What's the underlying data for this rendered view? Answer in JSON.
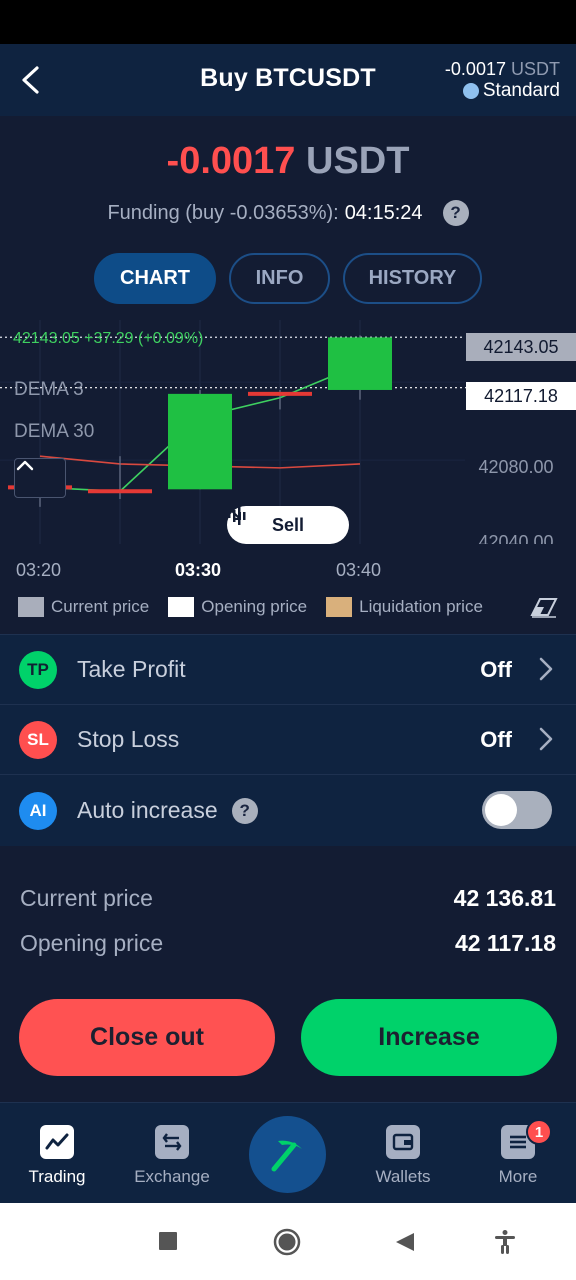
{
  "header": {
    "title": "Buy BTCUSDT",
    "pnl_small": "-0.0017",
    "pnl_small_unit": "USDT",
    "mode": "Standard"
  },
  "summary": {
    "pnl_value": "-0.0017",
    "pnl_unit": "USDT",
    "funding_label": "Funding (buy -0.03653%):",
    "funding_time": "04:15:24"
  },
  "tabs": [
    "CHART",
    "INFO",
    "HISTORY"
  ],
  "chart": {
    "ticker": "42143.05  +37.29 (+0.09%)",
    "indicator1": "DEMA 3",
    "indicator2": "DEMA 30",
    "current_price_tag": "42143.05",
    "opening_price_tag": "42117.18",
    "axis_labels": [
      "42080.00",
      "42040.00"
    ],
    "sell_label": "Sell",
    "time_labels": [
      "03:20",
      "03:30",
      "03:40"
    ]
  },
  "chart_data": {
    "type": "candlestick",
    "x": [
      "03:20",
      "03:25",
      "03:30",
      "03:35",
      "03:40"
    ],
    "ohlc": [
      {
        "t": "03:20",
        "open": 42066,
        "high": 42070,
        "low": 42056,
        "close": 42066
      },
      {
        "t": "03:25",
        "open": 42064,
        "high": 42082,
        "low": 42060,
        "close": 42064
      },
      {
        "t": "03:30",
        "open": 42065,
        "high": 42116,
        "low": 42065,
        "close": 42114
      },
      {
        "t": "03:35",
        "open": 42114,
        "high": 42116,
        "low": 42106,
        "close": 42114
      },
      {
        "t": "03:40",
        "open": 42116,
        "high": 42144,
        "low": 42111,
        "close": 42143
      }
    ],
    "series": [
      {
        "name": "DEMA 3",
        "x": [
          "03:20",
          "03:25",
          "03:30",
          "03:35",
          "03:40"
        ],
        "values": [
          42066,
          42064,
          42102,
          42112,
          42129
        ]
      },
      {
        "name": "DEMA 30",
        "x": [
          "03:20",
          "03:25",
          "03:30",
          "03:35",
          "03:40"
        ],
        "values": [
          42082,
          42078,
          42077,
          42076,
          42078
        ]
      }
    ],
    "current_price": 42143.05,
    "opening_price": 42117.18,
    "ylim": [
      42040,
      42155
    ],
    "colors": {
      "up": "#1fc043",
      "down": "#e53935",
      "dema3": "#3ed060",
      "dema30": "#d9493f"
    }
  },
  "legend": [
    {
      "label": "Current price",
      "color": "#a9aebb"
    },
    {
      "label": "Opening price",
      "color": "#ffffff"
    },
    {
      "label": "Liquidation price",
      "color": "#d9b07c"
    }
  ],
  "options": {
    "take_profit": {
      "badge": "TP",
      "label": "Take Profit",
      "value": "Off"
    },
    "stop_loss": {
      "badge": "SL",
      "label": "Stop Loss",
      "value": "Off"
    },
    "auto_increase": {
      "badge": "AI",
      "label": "Auto increase",
      "enabled": false
    }
  },
  "prices": {
    "current_label": "Current price",
    "current_value": "42 136.81",
    "opening_label": "Opening price",
    "opening_value": "42 117.18"
  },
  "actions": {
    "close_label": "Close out",
    "increase_label": "Increase"
  },
  "nav": {
    "trading": "Trading",
    "exchange": "Exchange",
    "wallets": "Wallets",
    "more": "More",
    "more_badge": "1"
  }
}
